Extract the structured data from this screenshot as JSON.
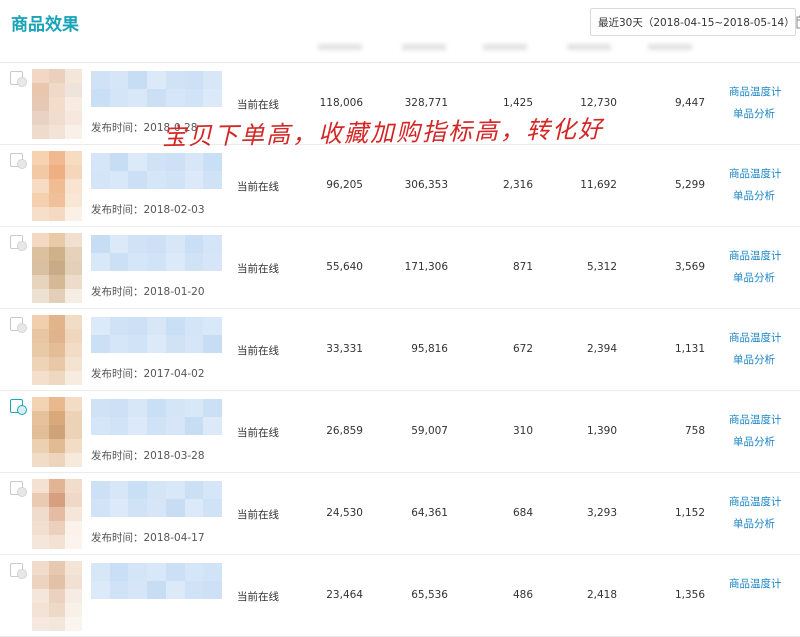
{
  "header": {
    "title": "商品效果",
    "date_range": "最近30天（2018-04-15~2018-05-14）",
    "calendar_day": "15"
  },
  "annotation": "宝贝下单高，收藏加购指标高，转化好",
  "rows": [
    {
      "pub_label": "发布时间：",
      "pub_date": "2018-0  28",
      "status": "当前在线",
      "v1": "118,006",
      "v2": "328,771",
      "v3": "1,425",
      "v4": "12,730",
      "v5": "9,447",
      "link1": "商品温度计",
      "link2": "单品分析"
    },
    {
      "pub_label": "发布时间：",
      "pub_date": "2018-02-03",
      "status": "当前在线",
      "v1": "96,205",
      "v2": "306,353",
      "v3": "2,316",
      "v4": "11,692",
      "v5": "5,299",
      "link1": "商品温度计",
      "link2": "单品分析"
    },
    {
      "pub_label": "发布时间：",
      "pub_date": "2018-01-20",
      "status": "当前在线",
      "v1": "55,640",
      "v2": "171,306",
      "v3": "871",
      "v4": "5,312",
      "v5": "3,569",
      "link1": "商品温度计",
      "link2": "单品分析"
    },
    {
      "pub_label": "发布时间：",
      "pub_date": "2017-04-02",
      "status": "当前在线",
      "v1": "33,331",
      "v2": "95,816",
      "v3": "672",
      "v4": "2,394",
      "v5": "1,131",
      "link1": "商品温度计",
      "link2": "单品分析"
    },
    {
      "pub_label": "发布时间：",
      "pub_date": "2018-03-28",
      "status": "当前在线",
      "v1": "26,859",
      "v2": "59,007",
      "v3": "310",
      "v4": "1,390",
      "v5": "758",
      "link1": "商品温度计",
      "link2": "单品分析"
    },
    {
      "pub_label": "发布时间：",
      "pub_date": "2018-04-17",
      "status": "当前在线",
      "v1": "24,530",
      "v2": "64,361",
      "v3": "684",
      "v4": "3,293",
      "v5": "1,152",
      "link1": "商品温度计",
      "link2": "单品分析"
    },
    {
      "pub_label": "",
      "pub_date": "",
      "status": "当前在线",
      "v1": "23,464",
      "v2": "65,536",
      "v3": "486",
      "v4": "2,418",
      "v5": "1,356",
      "link1": "商品温度计",
      "link2": ""
    }
  ],
  "colors": {
    "accent": "#19a3b6",
    "link": "#1b85c5",
    "annotation": "#d42626"
  }
}
